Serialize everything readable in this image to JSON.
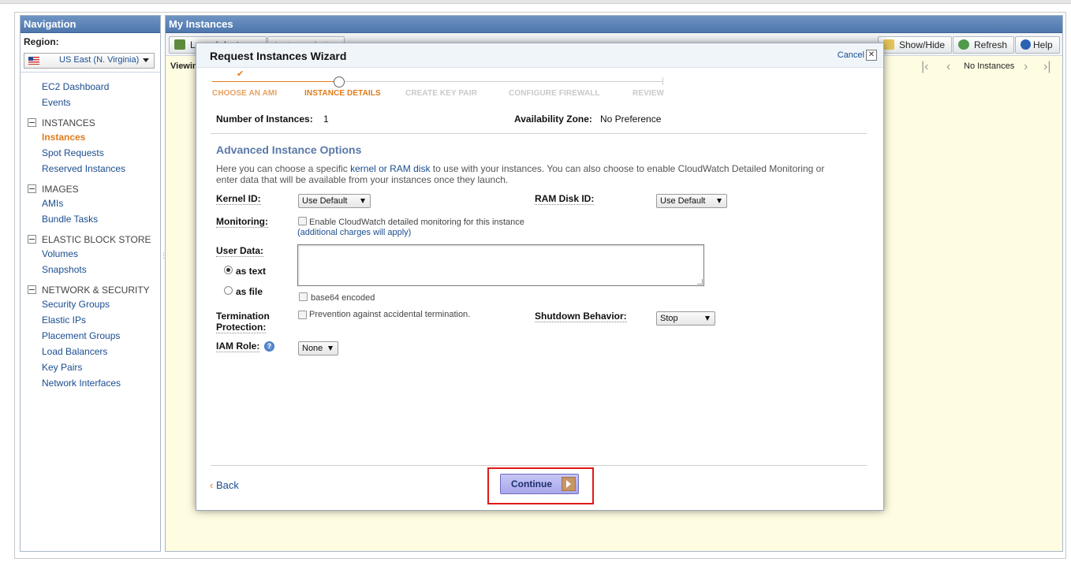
{
  "nav": {
    "title": "Navigation",
    "region_label": "Region:",
    "region_value": "US East (N. Virginia)",
    "links_top": [
      "EC2 Dashboard",
      "Events"
    ],
    "groups": [
      {
        "title": "INSTANCES",
        "items": [
          "Instances",
          "Spot Requests",
          "Reserved Instances"
        ]
      },
      {
        "title": "IMAGES",
        "items": [
          "AMIs",
          "Bundle Tasks"
        ]
      },
      {
        "title": "ELASTIC BLOCK STORE",
        "items": [
          "Volumes",
          "Snapshots"
        ]
      },
      {
        "title": "NETWORK & SECURITY",
        "items": [
          "Security Groups",
          "Elastic IPs",
          "Placement Groups",
          "Load Balancers",
          "Key Pairs",
          "Network Interfaces"
        ]
      }
    ],
    "active_item": "Instances"
  },
  "main": {
    "title": "My Instances",
    "toolbar": {
      "launch": "Launch Instance",
      "actions": "Instance Actions",
      "show_hide": "Show/Hide",
      "refresh": "Refresh",
      "help": "Help"
    },
    "viewing_label": "Viewing:",
    "pager_text": "No Instances"
  },
  "wizard": {
    "title": "Request Instances Wizard",
    "cancel": "Cancel",
    "steps": [
      "CHOOSE AN AMI",
      "INSTANCE DETAILS",
      "CREATE KEY PAIR",
      "CONFIGURE FIREWALL",
      "REVIEW"
    ],
    "num_instances_label": "Number of Instances:",
    "num_instances_value": "1",
    "az_label": "Availability Zone:",
    "az_value": "No Preference",
    "section_title": "Advanced Instance Options",
    "desc_before": "Here you can choose a specific ",
    "desc_link": "kernel or RAM disk",
    "desc_after": " to use with your instances. You can also choose to enable CloudWatch Detailed Monitoring or enter data that will be available from your instances once they launch.",
    "kernel_label": "Kernel ID:",
    "kernel_value": "Use Default",
    "ramdisk_label": "RAM Disk ID:",
    "ramdisk_value": "Use Default",
    "monitoring_label": "Monitoring:",
    "monitoring_text": "Enable CloudWatch detailed monitoring for this instance",
    "monitoring_note": "(additional charges will apply)",
    "userdata_label": "User Data:",
    "as_text": "as text",
    "as_file": "as file",
    "base64": "base64 encoded",
    "termination_label_1": "Termination",
    "termination_label_2": "Protection:",
    "termination_text": "Prevention against accidental termination.",
    "shutdown_label": "Shutdown Behavior:",
    "shutdown_value": "Stop",
    "iam_label": "IAM Role:",
    "iam_value": "None",
    "back": "Back",
    "continue": "Continue"
  }
}
